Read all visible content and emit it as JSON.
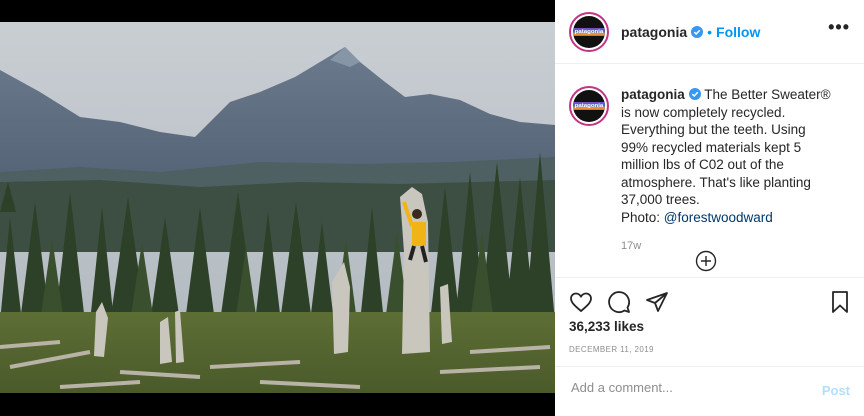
{
  "header": {
    "username": "patagonia",
    "separator": "•",
    "follow_label": "Follow",
    "more_label": "•••"
  },
  "avatar": {
    "logo_text": "patagonia"
  },
  "caption": {
    "username": "patagonia",
    "text": "The Better Sweater® is now completely recycled. Everything but the teeth. Using 99% recycled materials kept 5 million lbs of C02 out of the atmosphere. That's like planting 37,000 trees.",
    "photo_prefix": "Photo:",
    "photo_credit": "@forestwoodward",
    "time_ago": "17w"
  },
  "stats": {
    "likes": "36,233 likes",
    "date": "DECEMBER 11, 2019"
  },
  "comment_box": {
    "placeholder": "Add a comment...",
    "post_label": "Post"
  },
  "icons": {
    "verified": "verified-badge-icon",
    "like": "heart-icon",
    "comment": "comment-bubble-icon",
    "share": "paper-plane-icon",
    "save": "bookmark-icon",
    "load_more": "plus-circle-icon",
    "more": "more-options-icon"
  },
  "colors": {
    "accent": "#0095f6",
    "link": "#00376b",
    "post_disabled": "#b2dffc",
    "jacket": "#f0b416"
  }
}
